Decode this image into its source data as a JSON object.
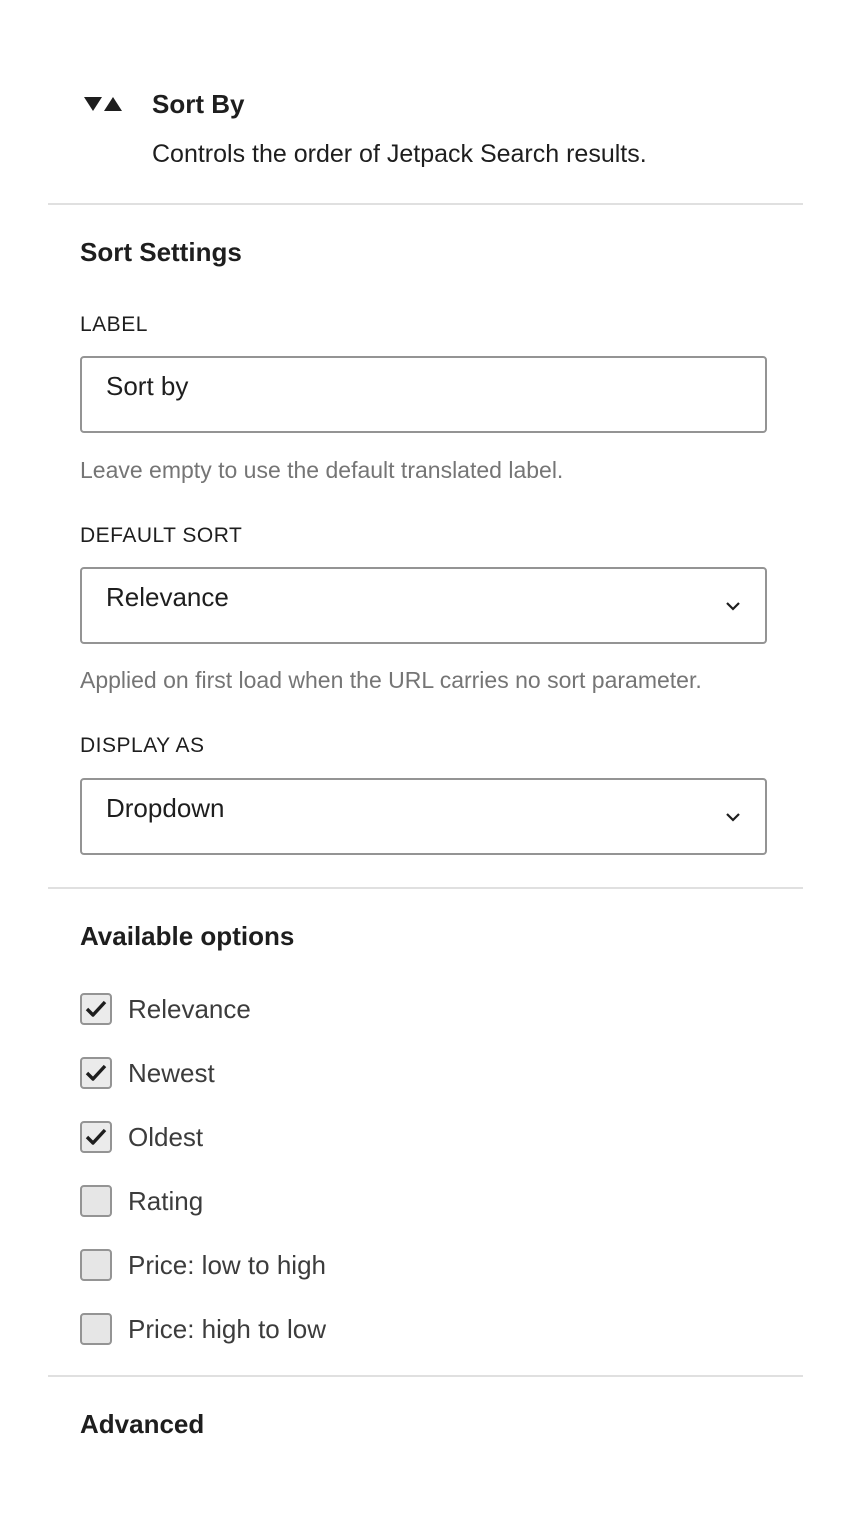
{
  "block": {
    "icon": "sort-arrows-icon",
    "title": "Sort By",
    "description": "Controls the order of Jetpack Search results."
  },
  "sort_settings": {
    "title": "Sort Settings",
    "label_field": {
      "label": "LABEL",
      "value": "Sort by",
      "help": "Leave empty to use the default translated label."
    },
    "default_sort": {
      "label": "DEFAULT SORT",
      "value": "Relevance",
      "help": "Applied on first load when the URL carries no sort parameter."
    },
    "display_as": {
      "label": "DISPLAY AS",
      "value": "Dropdown"
    }
  },
  "available_options": {
    "title": "Available options",
    "items": [
      {
        "label": "Relevance",
        "checked": true
      },
      {
        "label": "Newest",
        "checked": true
      },
      {
        "label": "Oldest",
        "checked": true
      },
      {
        "label": "Rating",
        "checked": false
      },
      {
        "label": "Price: low to high",
        "checked": false
      },
      {
        "label": "Price: high to low",
        "checked": false
      }
    ]
  },
  "advanced": {
    "title": "Advanced"
  },
  "colors": {
    "text": "#1e1e1e",
    "help_text": "#757575",
    "border": "#949494",
    "divider": "#e0e0e0"
  }
}
